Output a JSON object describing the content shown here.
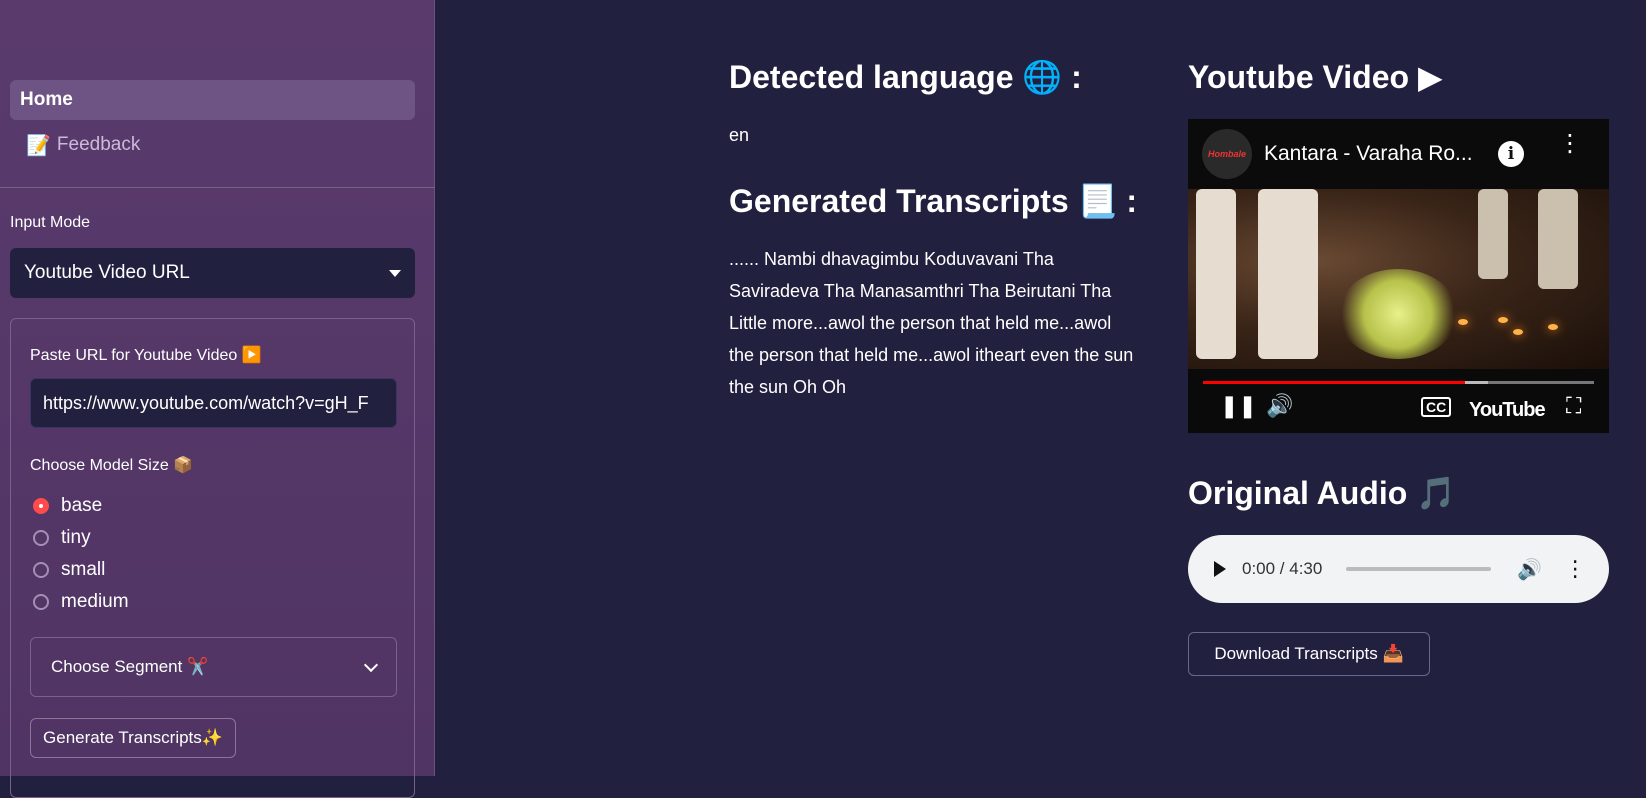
{
  "sidebar": {
    "nav": [
      {
        "label": "Home",
        "icon": "none"
      },
      {
        "label": "Feedback",
        "icon": "memo-icon",
        "glyph": "📝"
      }
    ],
    "input_mode": {
      "label": "Input Mode",
      "selected": "Youtube Video URL"
    },
    "form": {
      "url_label": "Paste URL for Youtube Video ▶️",
      "url_value": "https://www.youtube.com/watch?v=gH_F",
      "model_label": "Choose Model Size 📦",
      "model_options": [
        "base",
        "tiny",
        "small",
        "medium"
      ],
      "model_selected": "base",
      "segment_label": "Choose Segment ✂️",
      "generate_label": "Generate Transcripts✨"
    }
  },
  "main": {
    "detected_heading": "Detected language 🌐 :",
    "detected_value": "en",
    "transcripts_heading": "Generated Transcripts 📃 :",
    "transcript_text": "...... Nambi dhavagimbu Koduvavani Tha Saviradeva Tha Manasamthri Tha Beirutani Tha Little more...awol the person that held me...awol the person that held me...awol itheart even the sun the sun Oh Oh",
    "video_heading": "Youtube Video ▶",
    "video": {
      "title": "Kantara - Varaha Ro...",
      "channel": "Hombale",
      "brand": "YouTube",
      "played_fraction": 0.67
    },
    "audio_heading": "Original Audio 🎵",
    "audio": {
      "time": "0:00 / 4:30"
    },
    "download_label": "Download Transcripts 📥"
  },
  "colors": {
    "sidebar_bg": "#563869",
    "main_bg": "#22203f",
    "accent": "#ff4b4b",
    "yt_red": "#ff0000"
  }
}
